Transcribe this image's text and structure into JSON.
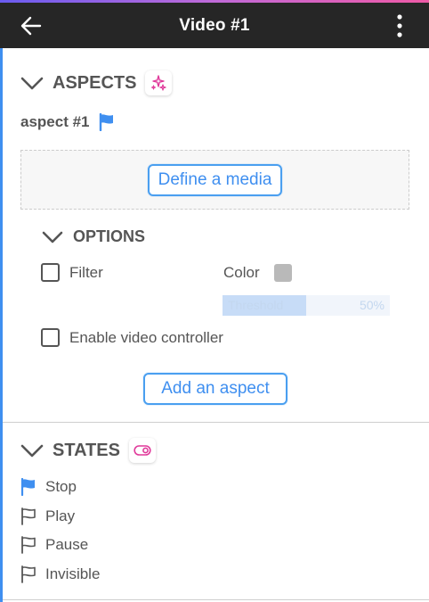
{
  "header": {
    "title": "Video #1",
    "bar_color": "#262626",
    "back_icon": "arrow-left-icon",
    "more_icon": "more-vertical-icon"
  },
  "aspects": {
    "title": "ASPECTS",
    "badge_icon": "sparkles-icon",
    "badge_color": "#e0399a",
    "items": [
      {
        "name": "aspect #1",
        "flag_icon": "flag-filled-icon",
        "flag_color": "#3f8ff0"
      }
    ],
    "define_media_label": "Define a media",
    "options": {
      "title": "OPTIONS",
      "filter_label": "Filter",
      "filter_checked": false,
      "color_label": "Color",
      "color_value": "#b9b9b9",
      "threshold_label": "Threshold",
      "threshold_value": "50%",
      "threshold_fraction": 0.5,
      "video_controller_label": "Enable video controller",
      "video_controller_checked": false
    },
    "add_aspect_label": "Add an aspect"
  },
  "states": {
    "title": "STATES",
    "badge_icon": "toggle-icon",
    "badge_color": "#e0399a",
    "items": [
      {
        "label": "Stop",
        "icon": "flag-filled-icon",
        "active": true
      },
      {
        "label": "Play",
        "icon": "flag-outline-icon",
        "active": false
      },
      {
        "label": "Pause",
        "icon": "flag-outline-icon",
        "active": false
      },
      {
        "label": "Invisible",
        "icon": "flag-outline-icon",
        "active": false
      }
    ]
  },
  "accent_color": "#3f8ff0"
}
